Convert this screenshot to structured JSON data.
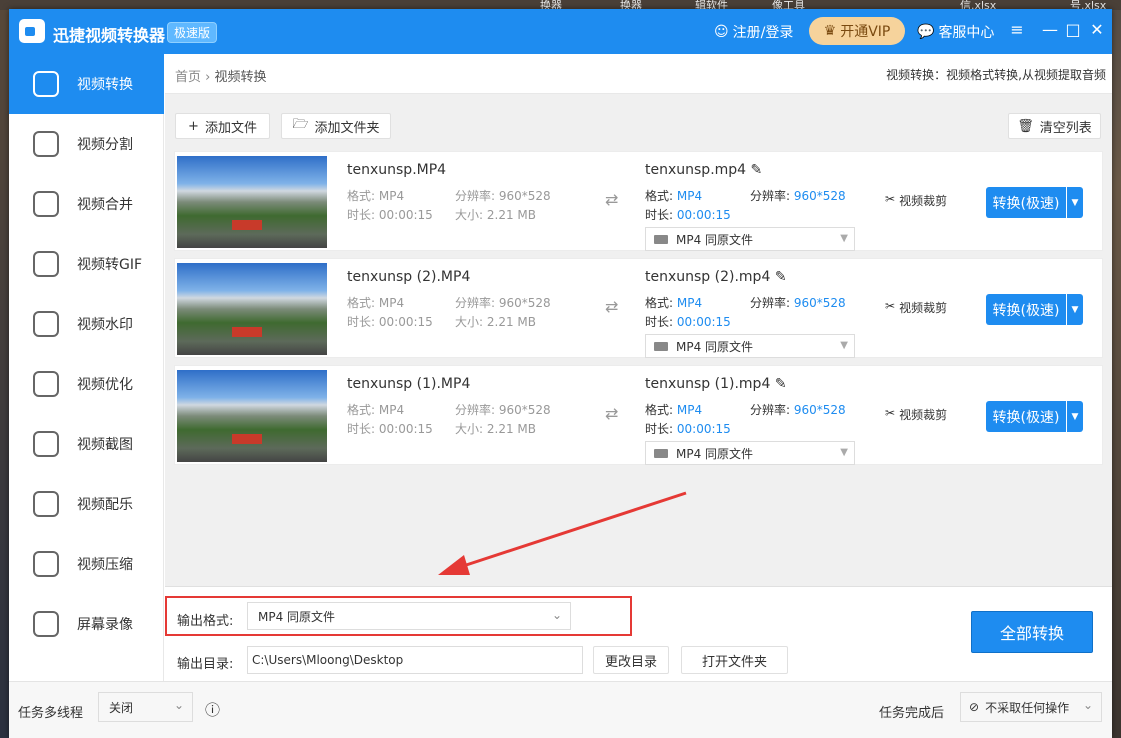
{
  "desktop": {
    "labels": [
      "换器",
      "换器",
      "辑软件",
      "像工具",
      "信.xlsx",
      "号.xlsx"
    ]
  },
  "app": {
    "title": "迅捷视频转换器",
    "badge": "极速版",
    "login": "注册/登录",
    "vip": "开通VIP",
    "support": "客服中心"
  },
  "sidebar": {
    "items": [
      {
        "label": "视频转换",
        "icon": "convert-icon"
      },
      {
        "label": "视频分割",
        "icon": "split-icon"
      },
      {
        "label": "视频合并",
        "icon": "merge-icon"
      },
      {
        "label": "视频转GIF",
        "icon": "gif-icon"
      },
      {
        "label": "视频水印",
        "icon": "watermark-icon"
      },
      {
        "label": "视频优化",
        "icon": "optimize-icon"
      },
      {
        "label": "视频截图",
        "icon": "screenshot-icon"
      },
      {
        "label": "视频配乐",
        "icon": "music-icon"
      },
      {
        "label": "视频压缩",
        "icon": "compress-icon"
      },
      {
        "label": "屏幕录像",
        "icon": "record-icon"
      }
    ]
  },
  "breadcrumb": {
    "home": "首页",
    "current": "视频转换",
    "hint": "视频转换：视频格式转换,从视频提取音频"
  },
  "toolbar": {
    "add_file": "添加文件",
    "add_folder": "添加文件夹",
    "clear": "清空列表"
  },
  "labels": {
    "format": "格式:",
    "resolution": "分辨率:",
    "duration": "时长:",
    "size": "大小:",
    "cut": "视频裁剪",
    "convert": "转换(极速)"
  },
  "files": [
    {
      "src_name": "tenxunsp.MP4",
      "src_format": "MP4",
      "src_res": "960*528",
      "src_dur": "00:00:15",
      "src_size": "2.21 MB",
      "out_name": "tenxunsp.mp4",
      "out_format": "MP4",
      "out_res": "960*528",
      "out_dur": "00:00:15",
      "out_sel": "MP4   同原文件"
    },
    {
      "src_name": "tenxunsp (2).MP4",
      "src_format": "MP4",
      "src_res": "960*528",
      "src_dur": "00:00:15",
      "src_size": "2.21 MB",
      "out_name": "tenxunsp (2).mp4",
      "out_format": "MP4",
      "out_res": "960*528",
      "out_dur": "00:00:15",
      "out_sel": "MP4   同原文件"
    },
    {
      "src_name": "tenxunsp (1).MP4",
      "src_format": "MP4",
      "src_res": "960*528",
      "src_dur": "00:00:15",
      "src_size": "2.21 MB",
      "out_name": "tenxunsp (1).mp4",
      "out_format": "MP4",
      "out_res": "960*528",
      "out_dur": "00:00:15",
      "out_sel": "MP4   同原文件"
    }
  ],
  "output": {
    "format_label": "输出格式:",
    "format_value": "MP4   同原文件",
    "dir_label": "输出目录:",
    "dir_value": "C:\\Users\\Mloong\\Desktop",
    "change_dir": "更改目录",
    "open_folder": "打开文件夹",
    "convert_all": "全部转换"
  },
  "status": {
    "threads_label": "任务多线程",
    "threads_value": "关闭",
    "after_label": "任务完成后",
    "after_value": "不采取任何操作"
  },
  "colors": {
    "accent": "#1e8cf0",
    "highlight": "#e53935"
  }
}
